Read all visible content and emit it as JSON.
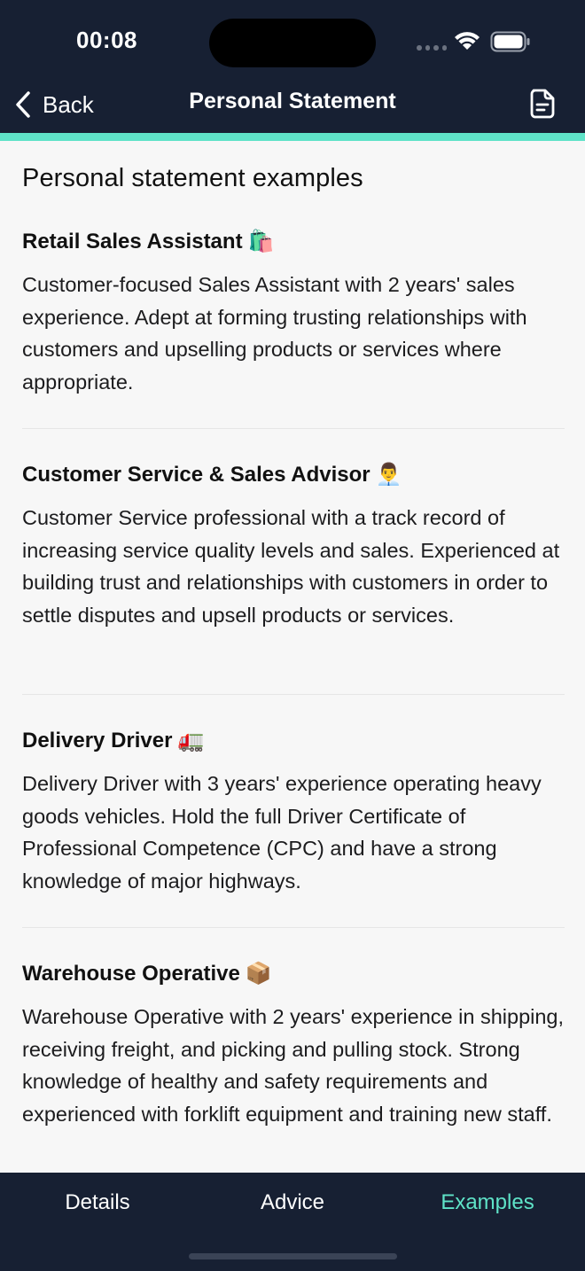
{
  "status_bar": {
    "time": "00:08"
  },
  "nav": {
    "back_label": "Back",
    "title": "Personal Statement",
    "back_icon": "chevron-left-icon",
    "action_icon": "document-icon"
  },
  "colors": {
    "header_bg": "#172033",
    "accent": "#5fe3c8",
    "page_bg": "#f7f7f7"
  },
  "main": {
    "section_title": "Personal statement examples",
    "examples": [
      {
        "title": "Retail Sales Assistant",
        "emoji": "🛍️",
        "body": "Customer-focused Sales Assistant with 2 years' sales experience. Adept at forming trusting relationships with customers and upselling products or services where appropriate."
      },
      {
        "title": "Customer Service & Sales Advisor",
        "emoji": "👨‍💼",
        "body": "Customer Service professional with a track record of increasing service quality levels and sales. Experienced at building trust and relationships with customers in order to settle disputes and upsell products or services."
      },
      {
        "title": "Delivery Driver",
        "emoji": "🚛",
        "body": "Delivery Driver with 3 years' experience operating heavy goods vehicles. Hold the full Driver Certificate of Professional Competence (CPC) and have a strong knowledge of major highways."
      },
      {
        "title": "Warehouse Operative",
        "emoji": "📦",
        "body": "Warehouse Operative with 2 years' experience in shipping, receiving freight, and picking and pulling stock. Strong knowledge of healthy and safety requirements and experienced with forklift equipment and training new staff."
      }
    ]
  },
  "tabs": [
    {
      "label": "Details",
      "active": false
    },
    {
      "label": "Advice",
      "active": false
    },
    {
      "label": "Examples",
      "active": true
    }
  ]
}
